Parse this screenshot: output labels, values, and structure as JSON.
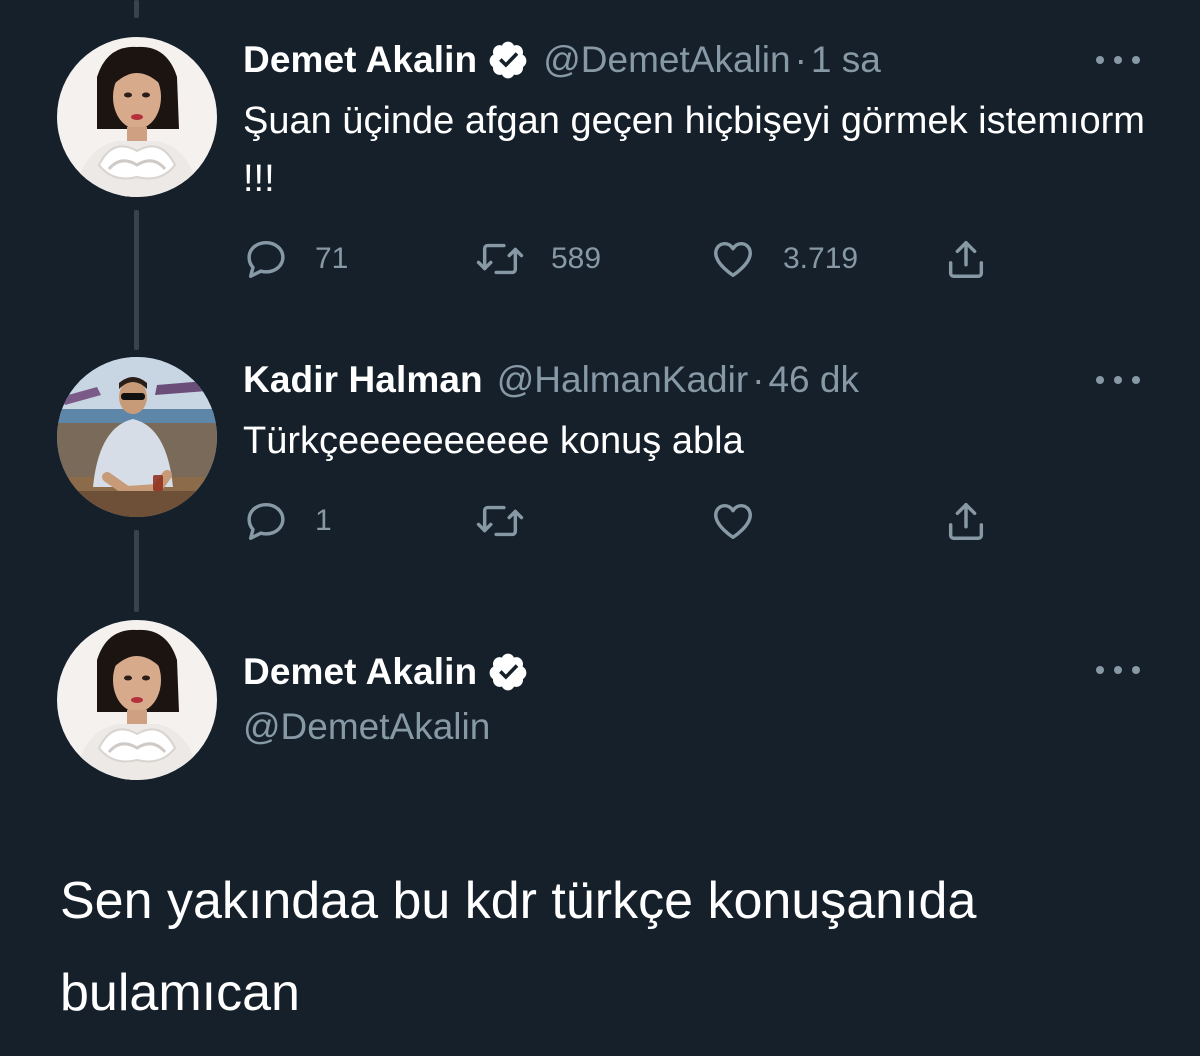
{
  "tweets": [
    {
      "name": "Demet Akalin",
      "verified": true,
      "handle": "@DemetAkalin",
      "separator": "·",
      "time": "1 sa",
      "text": "Şuan üçinde afgan geçen hiçbişeyi görmek istemıorm !!!",
      "replies": "71",
      "retweets": "589",
      "likes": "3.719"
    },
    {
      "name": "Kadir Halman",
      "verified": false,
      "handle": "@HalmanKadir",
      "separator": "·",
      "time": "46 dk",
      "text": "Türkçeeeeeeeeee konuş abla",
      "replies": "1",
      "retweets": "",
      "likes": ""
    }
  ],
  "focused_tweet": {
    "name": "Demet Akalin",
    "verified": true,
    "handle": "@DemetAkalin",
    "text": "Sen yakındaa bu kdr türkçe konuşanıda bulamıcan"
  },
  "colors": {
    "background": "#15202b",
    "text_primary": "#ffffff",
    "text_secondary": "#8899a6",
    "thread_line": "#38444d"
  },
  "icons": [
    "verified-badge-icon",
    "more-icon",
    "reply-icon",
    "retweet-icon",
    "like-icon",
    "share-icon"
  ]
}
